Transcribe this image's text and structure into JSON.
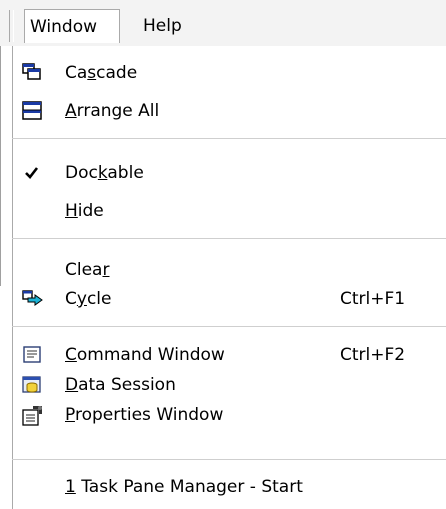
{
  "menubar": {
    "window": "Window",
    "help": "Help"
  },
  "items": [
    {
      "pre": "Ca",
      "acc": "s",
      "post": "cade",
      "shortcut": "",
      "icon": "cascade-icon"
    },
    {
      "pre": "",
      "acc": "A",
      "post": "rrange All",
      "shortcut": "",
      "icon": "arrange-all-icon"
    },
    {
      "pre": "Doc",
      "acc": "k",
      "post": "able",
      "shortcut": "",
      "icon": "checkmark-icon",
      "checked": true
    },
    {
      "pre": "",
      "acc": "H",
      "post": "ide",
      "shortcut": "",
      "icon": ""
    },
    {
      "pre": "Clea",
      "acc": "r",
      "post": "",
      "shortcut": "",
      "icon": ""
    },
    {
      "pre": "C",
      "acc": "y",
      "post": "cle",
      "shortcut": "Ctrl+F1",
      "icon": "cycle-icon"
    },
    {
      "pre": "",
      "acc": "C",
      "post": "ommand Window",
      "shortcut": "Ctrl+F2",
      "icon": "command-window-icon"
    },
    {
      "pre": "",
      "acc": "D",
      "post": "ata Session",
      "shortcut": "",
      "icon": "data-session-icon"
    },
    {
      "pre": "",
      "acc": "P",
      "post": "roperties Window",
      "shortcut": "",
      "icon": "properties-window-icon"
    },
    {
      "pre": "",
      "acc": "1",
      "post": " Task Pane Manager - Start",
      "shortcut": "",
      "icon": ""
    }
  ]
}
